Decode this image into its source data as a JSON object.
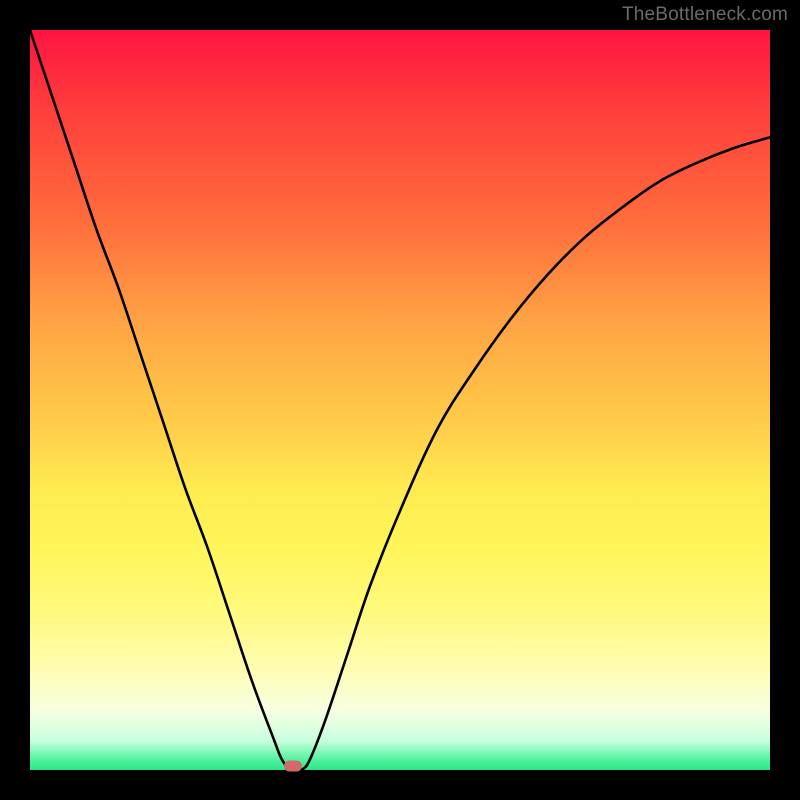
{
  "watermark": "TheBottleneck.com",
  "colors": {
    "frame": "#000000",
    "marker": "#d36a6a",
    "curve": "#000000",
    "gradient_top": "#ff1442",
    "gradient_bottom": "#28e888"
  },
  "chart_data": {
    "type": "line",
    "title": "",
    "xlabel": "",
    "ylabel": "",
    "xlim": [
      0,
      100
    ],
    "ylim": [
      0,
      100
    ],
    "grid": false,
    "legend": null,
    "annotations": [],
    "series": [
      {
        "name": "bottleneck-curve",
        "x": [
          0,
          3,
          6,
          9,
          12,
          15,
          18,
          21,
          24,
          27,
          30,
          33,
          34,
          35,
          36,
          37,
          38,
          40,
          43,
          46,
          50,
          55,
          60,
          65,
          70,
          75,
          80,
          85,
          90,
          95,
          100
        ],
        "y": [
          100,
          91,
          82,
          73,
          65,
          56,
          47,
          38,
          30,
          21,
          12,
          4,
          1.5,
          0.2,
          0,
          0.2,
          1.8,
          7,
          16,
          25,
          35,
          46,
          54,
          61,
          67,
          72,
          76,
          79.5,
          82,
          84,
          85.5
        ]
      }
    ],
    "marker": {
      "x": 35.5,
      "y": 0
    }
  }
}
